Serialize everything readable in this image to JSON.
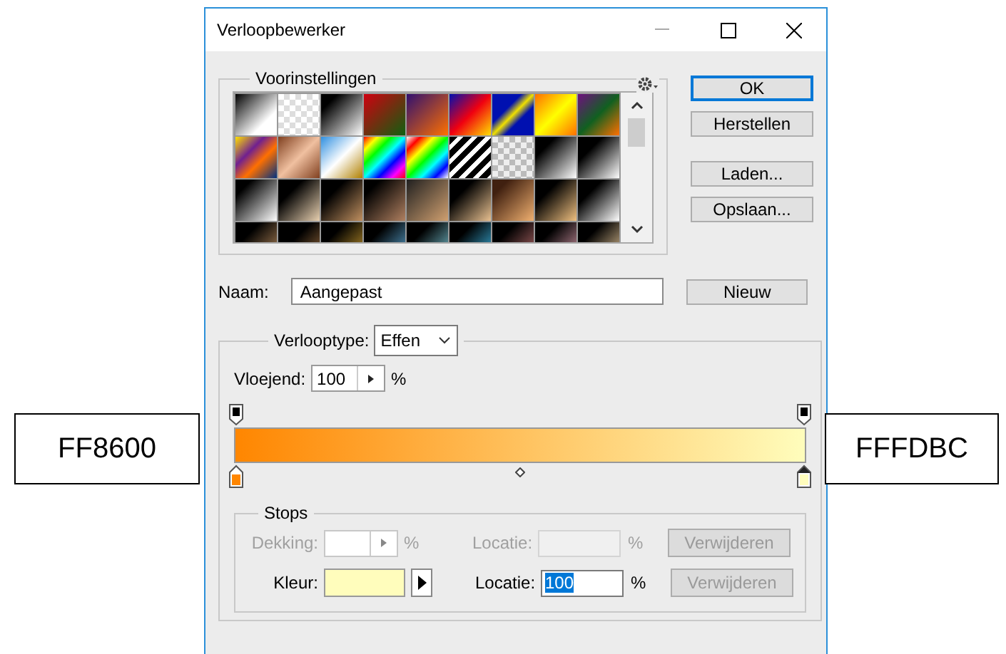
{
  "window": {
    "title": "Verloopbewerker"
  },
  "presets": {
    "legend": "Voorinstellingen"
  },
  "buttons": [
    {
      "label": "OK",
      "focused": true
    },
    {
      "label": "Herstellen",
      "focused": false
    },
    {
      "label": "Laden...",
      "focused": false
    },
    {
      "label": "Opslaan...",
      "focused": false
    }
  ],
  "name": {
    "label": "Naam:",
    "value": "Aangepast",
    "button": "Nieuw"
  },
  "gradient": {
    "type_label": "Verlooptype:",
    "type_value": "Effen",
    "smoothness_label": "Vloejend:",
    "smoothness_value": "100",
    "smoothness_unit": "%",
    "opacity_stops": [
      {
        "selected": false
      },
      {
        "selected": false
      }
    ],
    "color_stops": [
      {
        "color": "#ff8600",
        "selected": false
      },
      {
        "color": "#fffdbc",
        "selected": true
      }
    ]
  },
  "stops": {
    "legend": "Stops",
    "rows": [
      {
        "kind": "opacity",
        "label": "Dekking:",
        "unit": "%",
        "location_label": "Locatie:",
        "location_unit": "%",
        "delete_label": "Verwijderen",
        "disabled": true,
        "delete_disabled": true
      },
      {
        "kind": "color",
        "label": "Kleur:",
        "color": "#fffdbc",
        "location_label": "Locatie:",
        "location_value": "100",
        "value_selected": true,
        "location_unit": "%",
        "delete_label": "Verwijderen",
        "disabled": false,
        "delete_disabled": true
      }
    ]
  },
  "callouts": [
    {
      "text": "FF8600"
    },
    {
      "text": "FFFDBC"
    }
  ]
}
